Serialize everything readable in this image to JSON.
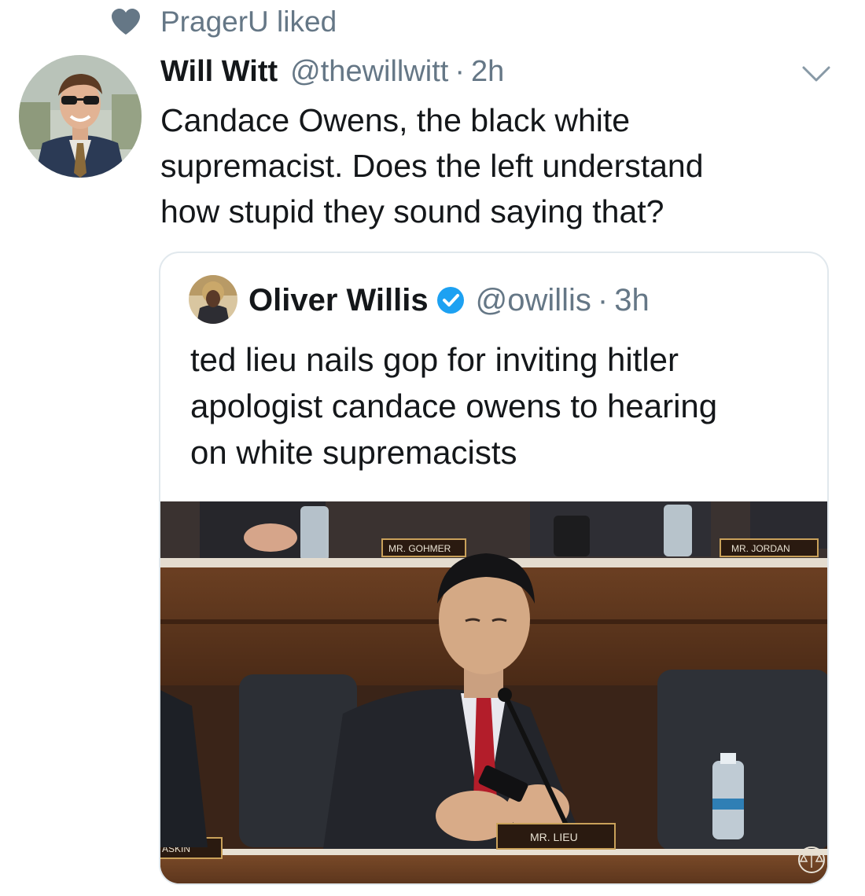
{
  "social_context": {
    "text": "PragerU liked",
    "icon": "heart-icon"
  },
  "tweet": {
    "display_name": "Will Witt",
    "handle": "@thewillwitt",
    "separator": "·",
    "time": "2h",
    "text_lines": [
      "Candace Owens, the black white",
      "supremacist. Does the left understand",
      "how stupid they sound saying that?"
    ],
    "menu_icon": "chevron-down-icon"
  },
  "quote": {
    "display_name": "Oliver Willis",
    "verified": true,
    "handle": "@owillis",
    "separator": "·",
    "time": "3h",
    "text_lines": [
      "ted lieu nails gop for inviting hitler",
      "apologist candace owens to hearing",
      "on white supremacists"
    ],
    "media": {
      "nameplates": {
        "gohmert": "MR. GOHMER",
        "jordan": "MR. JORDAN",
        "lieu": "MR. LIEU",
        "raskin": "ASKIN"
      },
      "watermark_icon": "scales-seal-icon"
    }
  },
  "colors": {
    "text_primary": "#14171a",
    "text_secondary": "#657786",
    "verified_blue": "#1da1f2",
    "card_border": "#e1e8ed"
  }
}
